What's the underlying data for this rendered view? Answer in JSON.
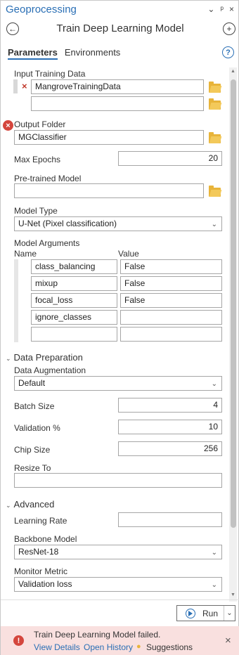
{
  "header": {
    "title": "Geoprocessing",
    "dropdown_icon": "⌄",
    "pin_icon": "ᵖ",
    "close_icon": "×"
  },
  "tool": {
    "title": "Train Deep Learning Model",
    "back_icon": "←",
    "add_icon": "+"
  },
  "tabs": [
    {
      "label": "Parameters"
    },
    {
      "label": "Environments"
    }
  ],
  "help_icon": "?",
  "params": {
    "input_training_data": {
      "label": "Input Training Data",
      "values": [
        "MangroveTrainingData",
        ""
      ],
      "remove_icon": "×"
    },
    "output_folder": {
      "label": "Output Folder",
      "value": "MGClassifier",
      "error_icon": "×"
    },
    "max_epochs": {
      "label": "Max Epochs",
      "value": "20"
    },
    "pretrained_model": {
      "label": "Pre-trained Model",
      "value": ""
    },
    "model_type": {
      "label": "Model Type",
      "value": "U-Net (Pixel classification)"
    },
    "model_arguments": {
      "label": "Model Arguments",
      "col_name": "Name",
      "col_value": "Value",
      "rows": [
        {
          "name": "class_balancing",
          "value": "False"
        },
        {
          "name": "mixup",
          "value": "False"
        },
        {
          "name": "focal_loss",
          "value": "False"
        },
        {
          "name": "ignore_classes",
          "value": ""
        },
        {
          "name": "",
          "value": ""
        }
      ]
    },
    "data_preparation": {
      "label": "Data Preparation"
    },
    "data_augmentation": {
      "label": "Data Augmentation",
      "value": "Default"
    },
    "batch_size": {
      "label": "Batch Size",
      "value": "4"
    },
    "validation_pct": {
      "label": "Validation %",
      "value": "10"
    },
    "chip_size": {
      "label": "Chip Size",
      "value": "256"
    },
    "resize_to": {
      "label": "Resize To",
      "value": ""
    },
    "advanced": {
      "label": "Advanced"
    },
    "learning_rate": {
      "label": "Learning Rate",
      "value": ""
    },
    "backbone_model": {
      "label": "Backbone Model",
      "value": "ResNet-18"
    },
    "monitor_metric": {
      "label": "Monitor Metric",
      "value": "Validation loss"
    }
  },
  "run": {
    "label": "Run",
    "chevron": "⌄"
  },
  "error": {
    "message": "Train Deep Learning Model failed.",
    "links": [
      "View Details",
      "Open History",
      "Suggestions"
    ],
    "icon": "!",
    "close": "×"
  }
}
